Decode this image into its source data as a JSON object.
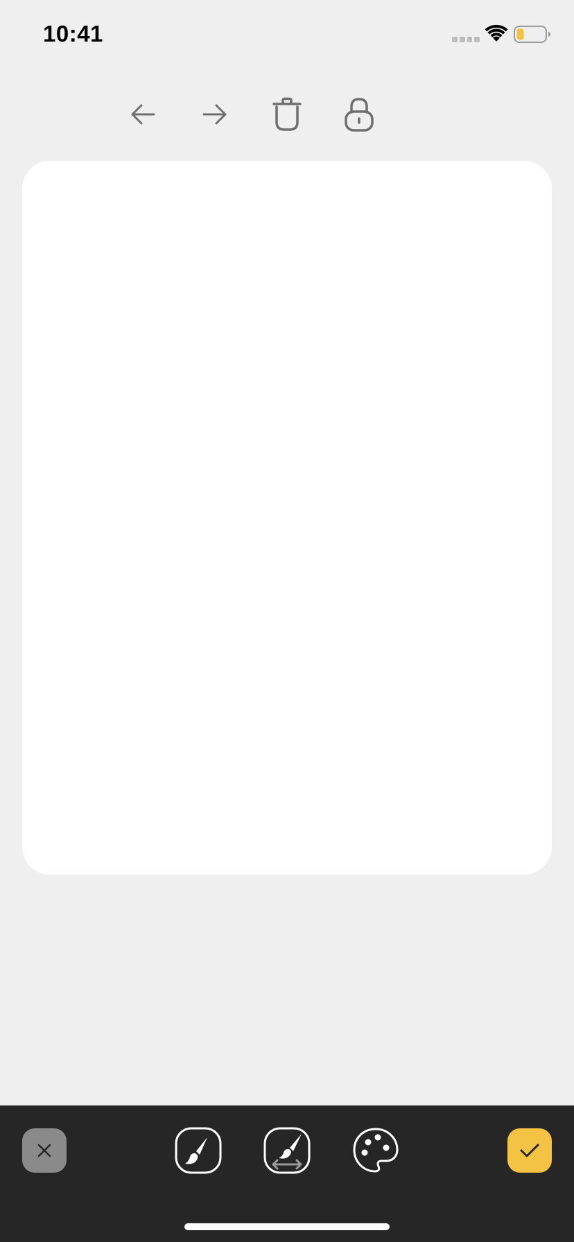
{
  "status_bar": {
    "time": "10:41",
    "battery_color": "#f5c344"
  },
  "toolbar": {
    "icons": [
      "back-arrow-icon",
      "forward-arrow-icon",
      "trash-icon",
      "lock-icon"
    ]
  },
  "bottom_bar": {
    "tools": [
      "brush-icon",
      "brush-size-icon",
      "palette-icon"
    ],
    "cancel_icon": "close-icon",
    "confirm_icon": "checkmark-icon"
  },
  "colors": {
    "background": "#efefef",
    "canvas": "#ffffff",
    "bottom_bar": "#262626",
    "accent": "#f5c344",
    "icon_gray": "#6e6e6e",
    "cancel_gray": "#8a8a8a"
  }
}
